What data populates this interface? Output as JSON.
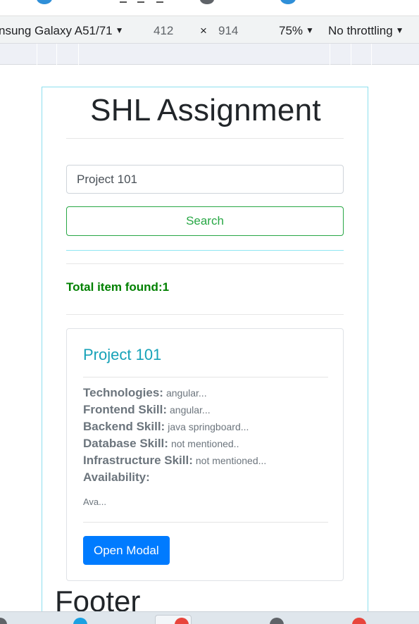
{
  "device_toolbar": {
    "device_name": "nsung Galaxy A51/71",
    "width": "412",
    "times": "×",
    "height": "914",
    "zoom": "75%",
    "throttling": "No throttling",
    "caret": "▼"
  },
  "page": {
    "title": "SHL Assignment",
    "search_value": "Project 101",
    "search_button_label": "Search",
    "total_label": "Total item found:1",
    "footer_heading": "Footer"
  },
  "card": {
    "title": "Project 101",
    "details": [
      {
        "label": "Technologies:",
        "value": "angular..."
      },
      {
        "label": "Frontend Skill:",
        "value": "angular..."
      },
      {
        "label": "Backend Skill:",
        "value": "java springboard..."
      },
      {
        "label": "Database Skill:",
        "value": "not mentioned.."
      },
      {
        "label": "Infrastructure Skill:",
        "value": "not mentioned..."
      },
      {
        "label": "Availability:",
        "value": ""
      }
    ],
    "availability_text": "Ava...",
    "button_label": "Open Modal"
  },
  "colors": {
    "accent_green": "#28a745",
    "total_green": "#008000",
    "card_title_cyan": "#17a2b8",
    "primary_blue": "#007bff"
  }
}
